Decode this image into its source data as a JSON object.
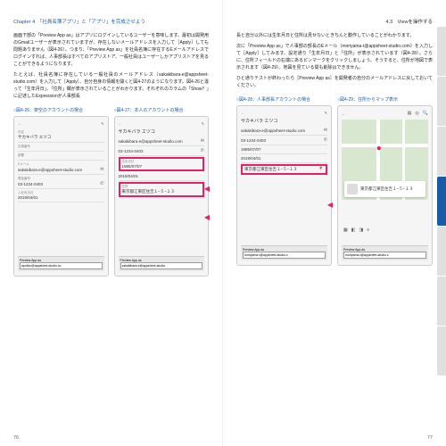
{
  "left": {
    "chapter": "Chapter 4　「社員名簿アプリ」と「アプリ」を完成させよう",
    "para1": "画面下部の「Preview App as」はアプリにログインしているユーザーを意味します。最初は開発用のGmailユーザーが表示されていますが、存在しないメールアドレスを入力して［Apply］しても問題ありません（図4-26）。つまり、「Preview App as」を社員名簿に存在するEメールアドレスでログインすれば、人事部長はすべてのアプリストア、一般社員はユーザーしかアプリストアを見ることができるようになります。",
    "para2": "たとえば、社員名簿に存在している一般社員のメールアドレス（sakakibara-e@appsheet-studio.com）を入力して［Apply］、自分自身の情報を開くと図4-27のようになります。図4-26と違って「生年月日」、「住所」欄が表示されていることがわかります。それぞれのカラムの「Show？」に記述したExpressionが人事部長",
    "fig26": {
      "cap": "○図4-26：架空のアカウントの場合",
      "name": "サカキバラ エツコ",
      "email": "sakakibara-e@appsheet-studio.com",
      "tel": "03-1234-0403",
      "date": "2019/04/01",
      "preview": "apollon@appsheet-studio.co",
      "lbl_name": "氏名",
      "lbl_id": "社員番号",
      "lbl_dept": "部署",
      "lbl_mail": "Eメール",
      "lbl_tel": "電話番号",
      "lbl_date": "入社年月日",
      "prev_lbl": "Preview App as"
    },
    "fig27": {
      "cap": "○図4-27：本人のアカウントの場合",
      "name": "サカキバラ エツコ",
      "email": "sakakibara-e@appsheet-studio.com",
      "tel": "03-1234-0403",
      "bd": "1985/07/07",
      "date": "2019/04/01",
      "addr": "東京都江東区住吉１−５−１３",
      "preview": "sakakibara-e@appsheet-studio.",
      "lbl_bd": "生年月日",
      "lbl_addr": "住所"
    }
  },
  "right": {
    "section": "4.3　Viewを操作する",
    "para1": "長と自分以外には生年月日と住所は見せないときちんと動作していることがわかります。",
    "para2": "次に「Preview App as」で人事部の部長のEメール（moriyama-t@appsheet-studio.com）を入力して［Apply］してみます。設定通り「生年月日」と「住所」が表示されています（図4-28）。さらに、住所フィールドの右端にあるピンマークをクリックしましょう。そうすると、住所が地図で表示されます（図4-29）。地図を見ている間も削除はできません。",
    "para3": "ひと通りテストが終わったら［Preview App as］を開発者の自分のメールアドレスに戻しておいてください。",
    "fig28": {
      "cap": "○図4-28：人事部長アカウントの場合",
      "name": "サカキバラ エツコ",
      "email": "sakakibara-e@appsheet-studio.com",
      "tel": "03-1234-0403",
      "bd": "1985/07/07",
      "date": "2019/04/01",
      "addr": "東京都江東区住吉１−５−１３",
      "preview": "moriyama-t@appsheet-studio.c"
    },
    "fig29": {
      "cap": "○図4-29：住所からマップ表示",
      "addr": "東京都江東区住吉１−５−１３",
      "preview": "moriyama-t@appsheet-studio.c"
    },
    "pg_l": "76",
    "pg_r": "77"
  }
}
